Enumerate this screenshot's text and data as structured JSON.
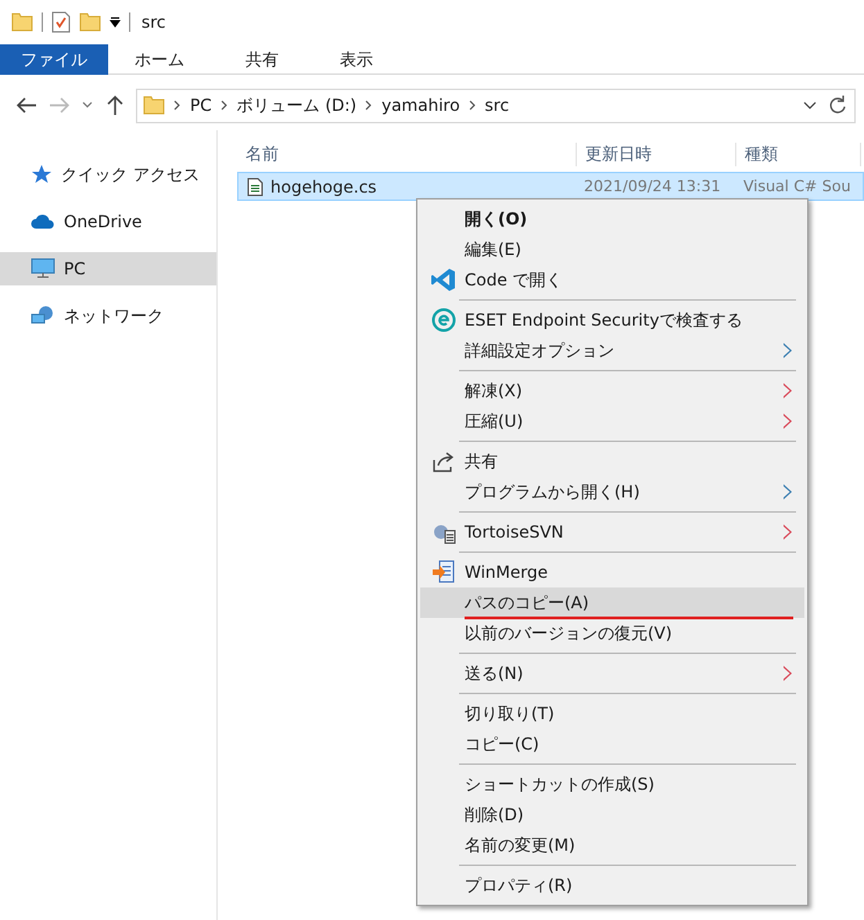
{
  "window": {
    "title": "src"
  },
  "ribbon_tabs": [
    {
      "label": "ファイル",
      "selected": true
    },
    {
      "label": "ホーム",
      "selected": false
    },
    {
      "label": "共有",
      "selected": false
    },
    {
      "label": "表示",
      "selected": false
    }
  ],
  "address": {
    "crumbs": [
      "PC",
      "ボリューム (D:)",
      "yamahiro",
      "src"
    ]
  },
  "sidebar": {
    "items": [
      {
        "label": "クイック アクセス",
        "kind": "quick",
        "selected": false
      },
      {
        "label": "OneDrive",
        "kind": "cloud",
        "selected": false
      },
      {
        "label": "PC",
        "kind": "pc",
        "selected": true
      },
      {
        "label": "ネットワーク",
        "kind": "network",
        "selected": false
      }
    ]
  },
  "table": {
    "columns": [
      "名前",
      "更新日時",
      "種類"
    ],
    "rows": [
      {
        "cells": [
          "hogehoge.cs",
          "2021/09/24 13:31",
          "Visual C# Sou"
        ],
        "selected": true
      }
    ]
  },
  "context_menu": {
    "items": [
      {
        "kind": "item",
        "label": "開く(O)",
        "bold": true
      },
      {
        "kind": "item",
        "label": "編集(E)"
      },
      {
        "kind": "code",
        "label": "Code で開く"
      },
      {
        "kind": "separator"
      },
      {
        "kind": "eset",
        "label": "ESET Endpoint Securityで検査する"
      },
      {
        "kind": "item",
        "label": "詳細設定オプション",
        "submenu": true,
        "color": "#3c7fb1"
      },
      {
        "kind": "separator"
      },
      {
        "kind": "item",
        "label": "解凍(X)",
        "submenu": true,
        "color": "#d94a5a"
      },
      {
        "kind": "item",
        "label": "圧縮(U)",
        "submenu": true,
        "color": "#d94a5a"
      },
      {
        "kind": "separator"
      },
      {
        "kind": "share",
        "label": "共有"
      },
      {
        "kind": "item",
        "label": "プログラムから開く(H)",
        "submenu": true,
        "color": "#3c7fb1"
      },
      {
        "kind": "separator"
      },
      {
        "kind": "svn",
        "label": "TortoiseSVN",
        "submenu": true,
        "color": "#d94a5a"
      },
      {
        "kind": "separator"
      },
      {
        "kind": "merge",
        "label": "WinMerge"
      },
      {
        "kind": "item",
        "label": "パスのコピー(A)",
        "selected": true,
        "underlined": true
      },
      {
        "kind": "item",
        "label": "以前のバージョンの復元(V)"
      },
      {
        "kind": "separator"
      },
      {
        "kind": "item",
        "label": "送る(N)",
        "submenu": true,
        "color": "#d94a5a"
      },
      {
        "kind": "separator"
      },
      {
        "kind": "item",
        "label": "切り取り(T)"
      },
      {
        "kind": "item",
        "label": "コピー(C)"
      },
      {
        "kind": "separator"
      },
      {
        "kind": "item",
        "label": "ショートカットの作成(S)"
      },
      {
        "kind": "item",
        "label": "削除(D)"
      },
      {
        "kind": "item",
        "label": "名前の変更(M)"
      },
      {
        "kind": "separator"
      },
      {
        "kind": "item",
        "label": "プロパティ(R)"
      }
    ]
  }
}
